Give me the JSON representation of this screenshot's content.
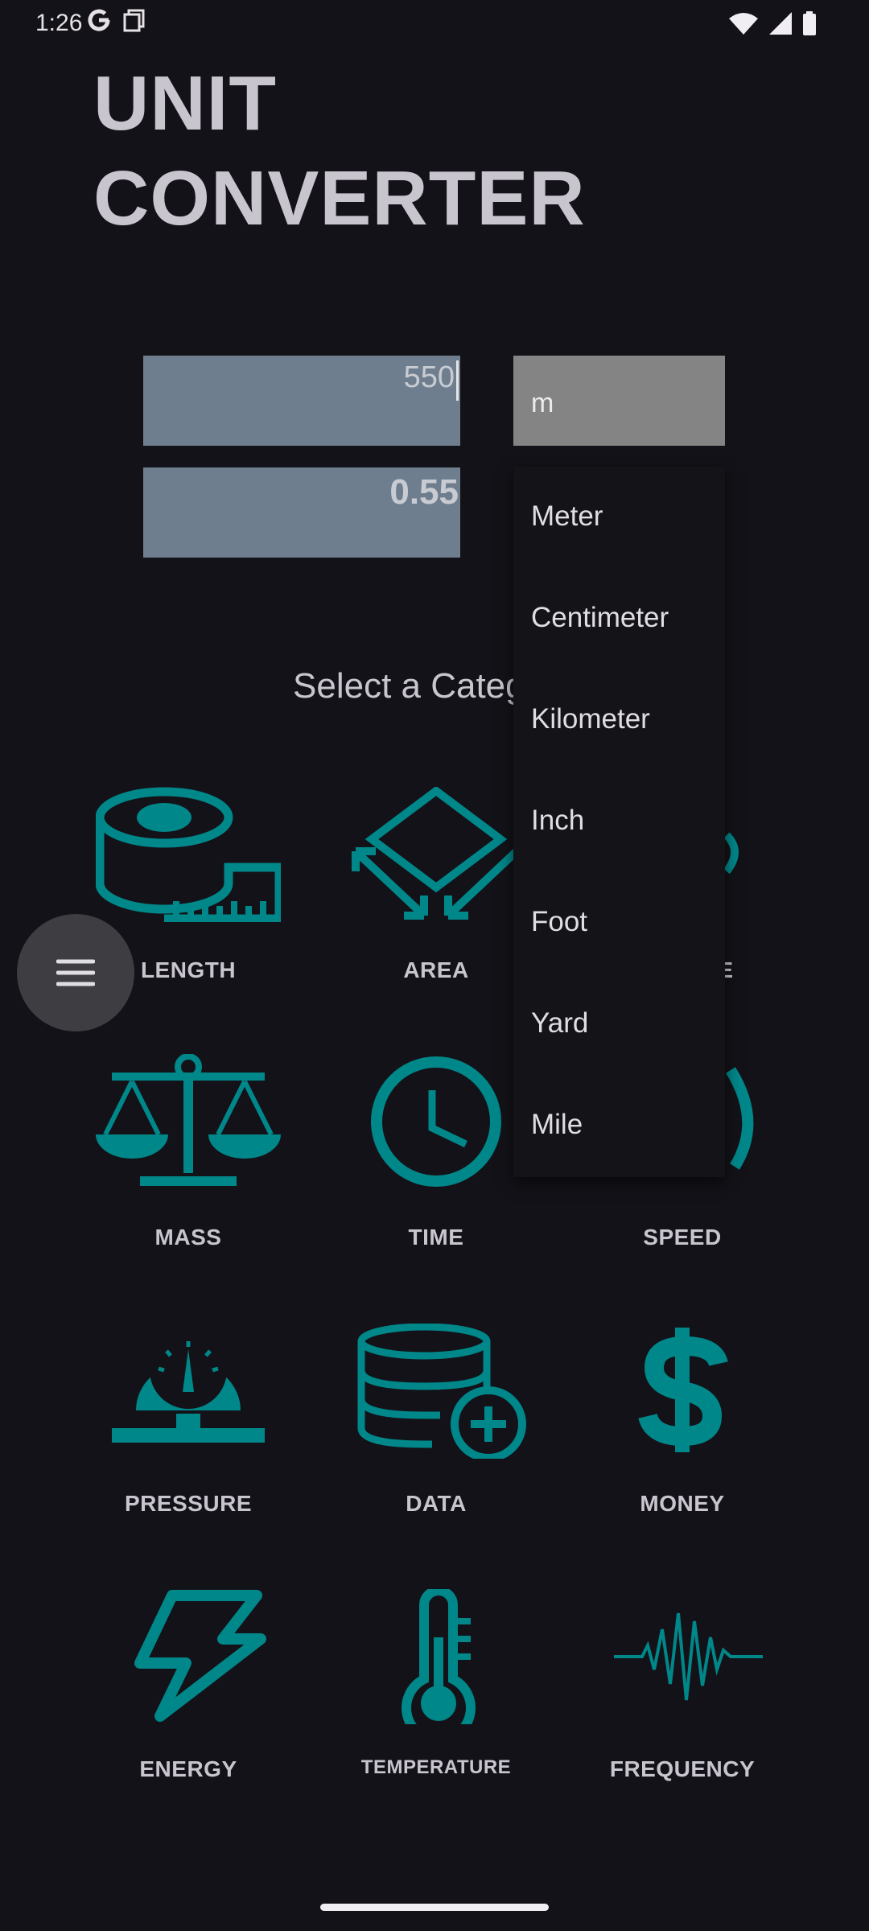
{
  "status": {
    "time": "1:26",
    "icons": [
      "google-g-icon",
      "screenshot-icon",
      "wifi-icon",
      "signal-icon",
      "battery-icon"
    ]
  },
  "app": {
    "title_line1": "UNIT",
    "title_line2": "CONVERTER"
  },
  "converter": {
    "input_value": "550",
    "output_value": "0.55",
    "selected_unit": "m"
  },
  "dropdown": {
    "options": [
      "Meter",
      "Centimeter",
      "Kilometer",
      "Inch",
      "Foot",
      "Yard",
      "Mile"
    ]
  },
  "categories": {
    "heading": "Select a Categ",
    "items": [
      "LENGTH",
      "AREA",
      "E",
      "MASS",
      "TIME",
      "SPEED",
      "PRESSURE",
      "DATA",
      "MONEY",
      "ENERGY",
      "TEMPERATURE",
      "FREQUENCY"
    ]
  },
  "colors": {
    "accent": "#00878a",
    "background": "#131218",
    "field": "#6f7e8e",
    "select": "#848484"
  }
}
